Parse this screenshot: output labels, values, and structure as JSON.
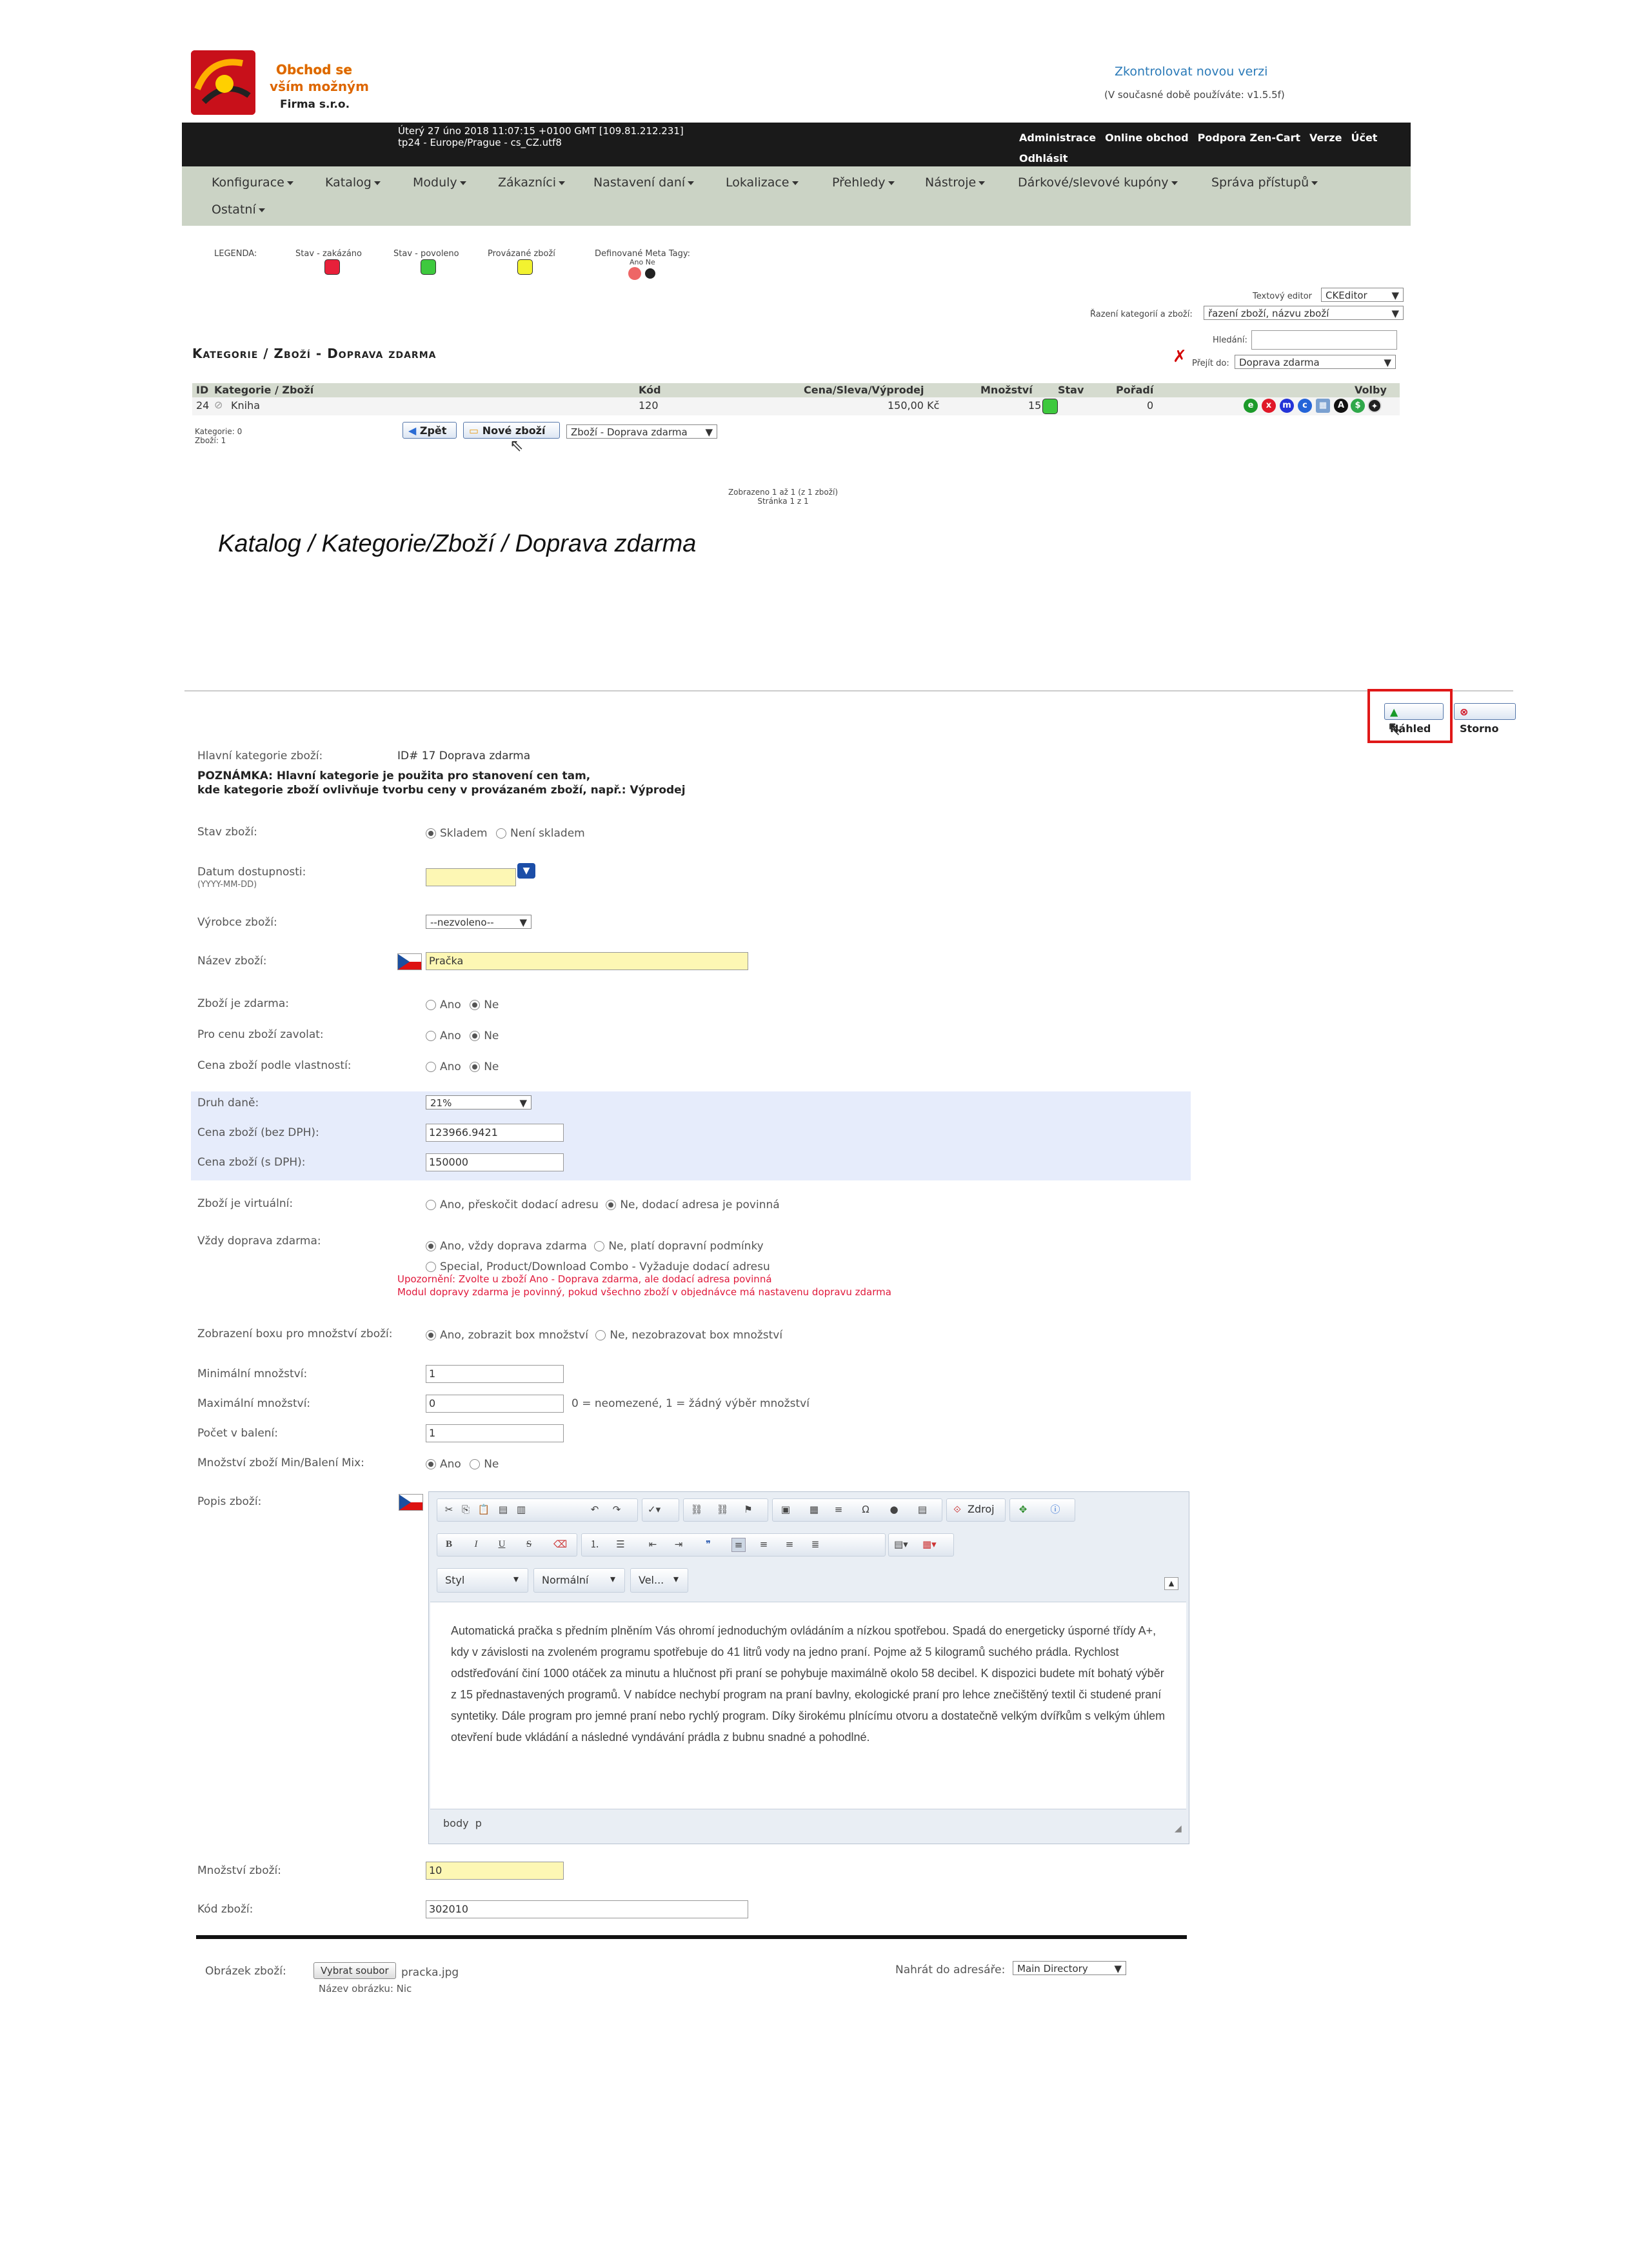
{
  "header": {
    "logo_line1": "Obchod se",
    "logo_line2": "vším možným",
    "logo_firm": "Firma s.r.o.",
    "check_version": "Zkontrolovat novou verzi",
    "current_version": "(V současné době používáte: v1.5.5f)",
    "info_line1": "Úterý 27 úno 2018 11:07:15 +0100 GMT [109.81.212.231]",
    "info_line2": "tp24 - Europe/Prague - cs_CZ.utf8",
    "nav": [
      "Administrace",
      "Online obchod",
      "Podpora Zen-Cart",
      "Verze",
      "Účet",
      "Odhlásit"
    ]
  },
  "menu": [
    "Konfigurace",
    "Katalog",
    "Moduly",
    "Zákazníci",
    "Nastavení daní",
    "Lokalizace",
    "Přehledy",
    "Nástroje",
    "Dárkové/slevové kupóny",
    "Správa přístupů",
    "Ostatní"
  ],
  "legend": {
    "title": "LEGENDA:",
    "disabled": "Stav - zakázáno",
    "enabled": "Stav - povoleno",
    "linked": "Provázané zboží",
    "meta": "Definované Meta Tagy:",
    "meta_yes_no": "Ano Ne"
  },
  "controls": {
    "text_editor_label": "Textový editor",
    "text_editor_value": "CKEditor",
    "sort_label": "Řazení kategorií a zboží:",
    "sort_value": "řazení zboží, názvu zboží",
    "search_label": "Hledání:",
    "goto_label": "Přejít do:",
    "goto_value": "Doprava zdarma"
  },
  "page_title": "Kategorie / Zboží - Doprava zdarma",
  "table": {
    "headers": [
      "ID",
      "Kategorie / Zboží",
      "Kód",
      "Cena/Sleva/Výprodej",
      "Množství",
      "Stav",
      "Pořadí",
      "Volby"
    ],
    "row": {
      "id": "24",
      "name": "Kniha",
      "code": "120",
      "price": "150,00 Kč",
      "qty": "15",
      "order": "0"
    },
    "counts_line1": "Kategorie: 0",
    "counts_line2": "Zboží: 1",
    "back_btn": "Zpět",
    "new_btn": "Nové zboží",
    "category_select": "Zboží - Doprava zdarma",
    "shown": "Zobrazeno 1 až 1 (z 1 zboží)",
    "page": "Stránka 1 z 1"
  },
  "caption": "Katalog / Kategorie/Zboží / Doprava zdarma",
  "form": {
    "preview_btn": "Náhled",
    "cancel_btn": "Storno",
    "main_cat_label": "Hlavní kategorie zboží:",
    "main_cat_value": "ID# 17 Doprava zdarma",
    "note1": "POZNÁMKA: Hlavní kategorie je použita pro stanovení cen tam,",
    "note2": "kde kategorie zboží ovlivňuje tvorbu ceny v provázaném zboží, např.: Výprodej",
    "status_label": "Stav zboží:",
    "status_opt1": "Skladem",
    "status_opt2": "Není skladem",
    "date_label": "Datum dostupnosti:",
    "date_hint": "(YYYY-MM-DD)",
    "maker_label": "Výrobce zboží:",
    "maker_value": "--nezvoleno--",
    "name_label": "Název zboží:",
    "name_value": "Pračka",
    "free_label": "Zboží je zdarma:",
    "call_label": "Pro cenu zboží zavolat:",
    "attr_label": "Cena zboží podle vlastností:",
    "yes": "Ano",
    "no": "Ne",
    "tax_label": "Druh daně:",
    "tax_value": "21%",
    "net_label": "Cena zboží (bez DPH):",
    "net_value": "123966.9421",
    "gross_label": "Cena zboží (s DPH):",
    "gross_value": "150000",
    "virtual_label": "Zboží je virtuální:",
    "virtual_opt1": "Ano, přeskočit dodací adresu",
    "virtual_opt2": "Ne, dodací adresa je povinná",
    "shipping_label": "Vždy doprava zdarma:",
    "shipping_opt1": "Ano, vždy doprava zdarma",
    "shipping_opt2": "Ne, platí dopravní podmínky",
    "shipping_opt3": "Special, Product/Download Combo - Vyžaduje dodací adresu",
    "warn1": "Upozornění: Zvolte u zboží Ano - Doprava zdarma, ale dodací adresa povinná",
    "warn2": "Modul dopravy zdarma je povinný, pokud všechno zboží v objednávce má nastavenu dopravu zdarma",
    "qtybox_label": "Zobrazení boxu pro množství zboží:",
    "qtybox_opt1": "Ano, zobrazit box množství",
    "qtybox_opt2": "Ne, nezobrazovat box množství",
    "min_label": "Minimální množství:",
    "min_value": "1",
    "max_label": "Maximální množství:",
    "max_value": "0",
    "max_hint": "0 = neomezené, 1 = žádný výběr množství",
    "pack_label": "Počet v balení:",
    "pack_value": "1",
    "mix_label": "Množství zboží Min/Balení Mix:",
    "desc_label": "Popis zboží:",
    "editor_source": "Zdroj",
    "editor_style": "Styl",
    "editor_format": "Normální",
    "editor_size": "Vel...",
    "editor_status": "body  p",
    "description": "Automatická pračka s předním plněním Vás ohromí jednoduchým ovládáním a nízkou spotřebou. Spadá do energeticky úsporné třídy A+, kdy v závislosti na zvoleném programu spotřebuje do 41 litrů vody na jedno praní. Pojme až 5 kilogramů suchého prádla. Rychlost odstřeďování činí 1000 otáček za minutu a hlučnost při praní se pohybuje maximálně okolo 58 decibel. K dispozici budete mít bohatý výběr z 15 přednastavených programů. V nabídce nechybí program na praní bavlny, ekologické praní pro lehce znečištěný textil či studené praní syntetiky. Dále program pro jemné praní nebo rychlý program. Díky širokému plnícímu otvoru a dostatečně velkým dvířkům s velkým úhlem otevření bude vkládání a následné vyndávání prádla z bubnu snadné a pohodlné.",
    "qty_label": "Množství zboží:",
    "qty_value": "10",
    "code_label": "Kód zboží:",
    "code_value": "302010",
    "image_label": "Obrázek zboží:",
    "choose_file": "Vybrat soubor",
    "file_name": "pracka.jpg",
    "image_name_label": "Název obrázku:",
    "image_name_value": "Nic",
    "upload_dir_label": "Nahrát do adresáře:",
    "upload_dir_value": "Main Directory"
  },
  "colors": {
    "menubar": "#cbd3c5",
    "topbar": "#1a1a1a",
    "highlight_box": "#e01818",
    "yellow_input": "#fdf7b4",
    "blue_block": "#e6ecfb"
  }
}
